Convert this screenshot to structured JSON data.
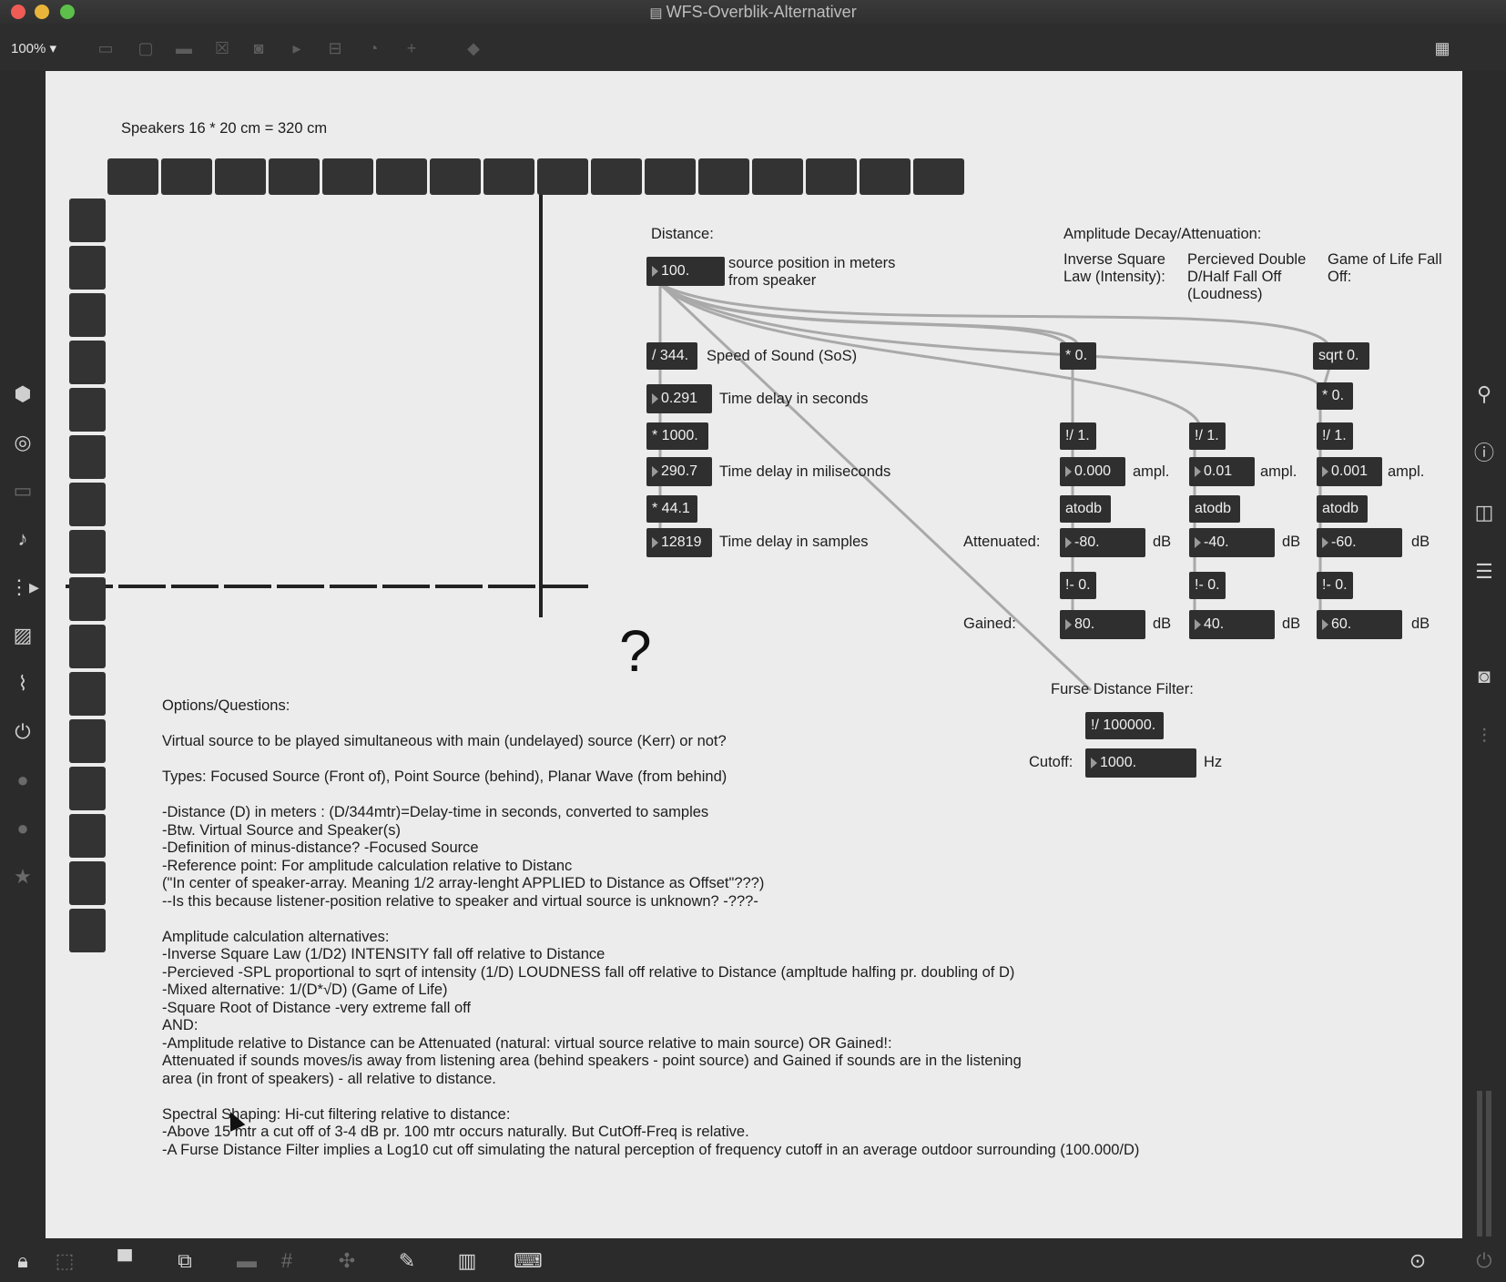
{
  "window": {
    "title": "WFS-Overblik-Alternativer",
    "zoom": "100%"
  },
  "patch": {
    "speakers_label": "Speakers 16 * 20 cm = 320 cm",
    "distance": {
      "label": "Distance:",
      "value": "100.",
      "caption_line1": "source position in meters",
      "caption_line2": "from speaker"
    },
    "sos": {
      "op": "/ 344.",
      "label": "Speed of Sound (SoS)",
      "delay_sec": "0.291",
      "delay_sec_label": "Time delay in seconds",
      "mul1000": "* 1000.",
      "delay_ms": "290.7",
      "delay_ms_label": "Time delay in miliseconds",
      "mul441": "* 44.1",
      "delay_samples": "12819",
      "delay_samples_label": "Time delay in samples"
    },
    "amplitude": {
      "heading": "Amplitude Decay/Attenuation:",
      "col1_title_1": "Inverse Square",
      "col1_title_2": "Law (Intensity):",
      "col2_title_1": "Percieved Double",
      "col2_title_2": "D/Half Fall Off",
      "col2_title_3": "(Loudness)",
      "col3_title_1": "Game of Life Fall",
      "col3_title_2": "Off:",
      "mul0": "* 0.",
      "sqrt": "sqrt 0.",
      "mul0b": "* 0.",
      "inv1": "!/ 1.",
      "inv2": "!/ 1.",
      "inv3": "!/ 1.",
      "ampl1": "0.000",
      "ampl2": "0.01",
      "ampl3": "0.001",
      "ampl_label": "ampl.",
      "atodb": "atodb",
      "attenuated_label": "Attenuated:",
      "att1": "-80.",
      "att2": "-40.",
      "att3": "-60.",
      "db_label": "dB",
      "neg0": "!- 0.",
      "gained_label": "Gained:",
      "gain1": "80.",
      "gain2": "40.",
      "gain3": "60."
    },
    "filter": {
      "heading": "Furse Distance Filter:",
      "op": "!/ 100000.",
      "cutoff_label": "Cutoff:",
      "cutoff_value": "1000.",
      "hz_label": "Hz"
    },
    "question_mark": "?",
    "notes": [
      "Options/Questions:",
      "",
      "Virtual source to be played simultaneous with main (undelayed) source (Kerr) or not?",
      "",
      "Types: Focused Source (Front of), Point Source (behind), Planar Wave (from behind)",
      "",
      "-Distance (D) in meters : (D/344mtr)=Delay-time in seconds, converted to samples",
      "-Btw. Virtual Source and Speaker(s)",
      "-Definition of minus-distance? -Focused Source",
      "-Reference point: For amplitude calculation relative to Distanc",
      "(\"In center of speaker-array. Meaning 1/2 array-lenght APPLIED to Distance as Offset\"???)",
      "--Is this because listener-position relative to speaker and virtual source is unknown? -???-",
      "",
      "Amplitude calculation alternatives:",
      "-Inverse Square Law (1/D2) INTENSITY fall off relative to Distance",
      "-Percieved -SPL proportional to sqrt of intensity (1/D) LOUDNESS fall off relative to Distance (ampltude halfing pr. doubling of D)",
      "-Mixed alternative: 1/(D*√D) (Game of Life)",
      "-Square Root of Distance  -very extreme fall off",
      "AND:",
      "-Amplitude relative to Distance can be Attenuated (natural: virtual source relative to main source) OR Gained!:",
      "Attenuated if sounds moves/is away from listening area (behind speakers - point source) and Gained if sounds are in the listening",
      "area (in front of speakers) - all relative to distance.",
      "",
      "Spectral Shaping: Hi-cut filtering relative to distance:",
      "-Above 15 mtr a cut off of 3-4 dB pr. 100 mtr occurs naturally. But CutOff-Freq is relative.",
      "-A Furse Distance Filter implies a Log10 cut off simulating the natural perception of frequency cutoff in an average outdoor surrounding (100.000/D)"
    ]
  },
  "colors": {
    "canvas": "#ececec",
    "object": "#2f2f2f",
    "chrome": "#2b2b2b",
    "patchcord": "#a9a9a9"
  },
  "icons": {
    "toolbar": [
      "presentation-icon",
      "message-icon",
      "comment-icon",
      "toggle-icon",
      "button-icon",
      "playbar-icon",
      "slider-icon",
      "dial-icon",
      "add-icon",
      "paint-bucket-icon",
      "grid-icon"
    ],
    "left_sidebar": [
      "cube-icon",
      "target-icon",
      "media-icon",
      "music-note-icon",
      "playlist-icon",
      "image-icon",
      "paperclip-icon",
      "plugin-icon",
      "vst-icon",
      "bpatcher-icon",
      "star-icon"
    ],
    "right_sidebar": [
      "search-icon",
      "info-icon",
      "columns-icon",
      "list-icon",
      "snapshot-icon",
      "mixer-icon",
      "level-meter-icon"
    ],
    "bottom": [
      "lock-icon",
      "edit-mode-icon",
      "presentation-icon",
      "window-icon",
      "debug-icon",
      "grid-icon",
      "snap-icon",
      "wrench-icon",
      "piano-icon",
      "keyboard-icon",
      "transport-icon",
      "power-icon"
    ]
  }
}
